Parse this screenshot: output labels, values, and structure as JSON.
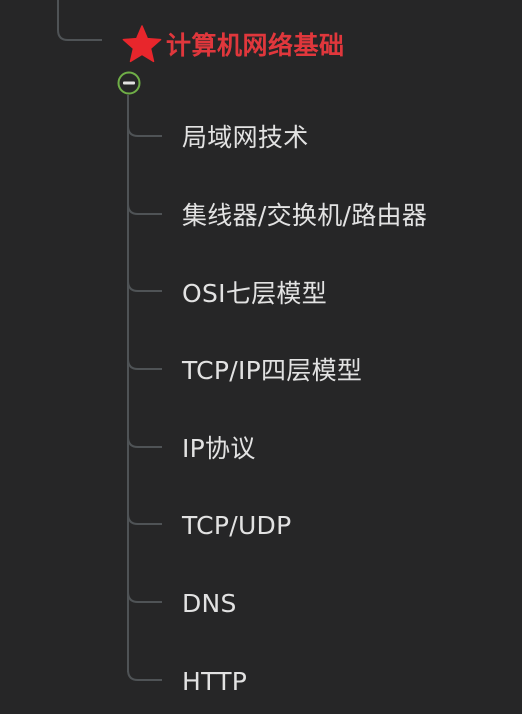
{
  "mindmap": {
    "root": {
      "label": "计算机网络基础",
      "icon": "star-icon",
      "color": "#e0373c"
    },
    "collapse_icon": "minus-circle-icon",
    "children": [
      {
        "label": "局域网技术"
      },
      {
        "label": "集线器/交换机/路由器"
      },
      {
        "label": "OSI七层模型"
      },
      {
        "label": "TCP/IP四层模型"
      },
      {
        "label": "IP协议"
      },
      {
        "label": "TCP/UDP"
      },
      {
        "label": "DNS"
      },
      {
        "label": "HTTP"
      }
    ]
  },
  "colors": {
    "background": "#262627",
    "text": "#e2e2e2",
    "connector": "#4f5356",
    "collapse_stroke": "#6fae47"
  }
}
